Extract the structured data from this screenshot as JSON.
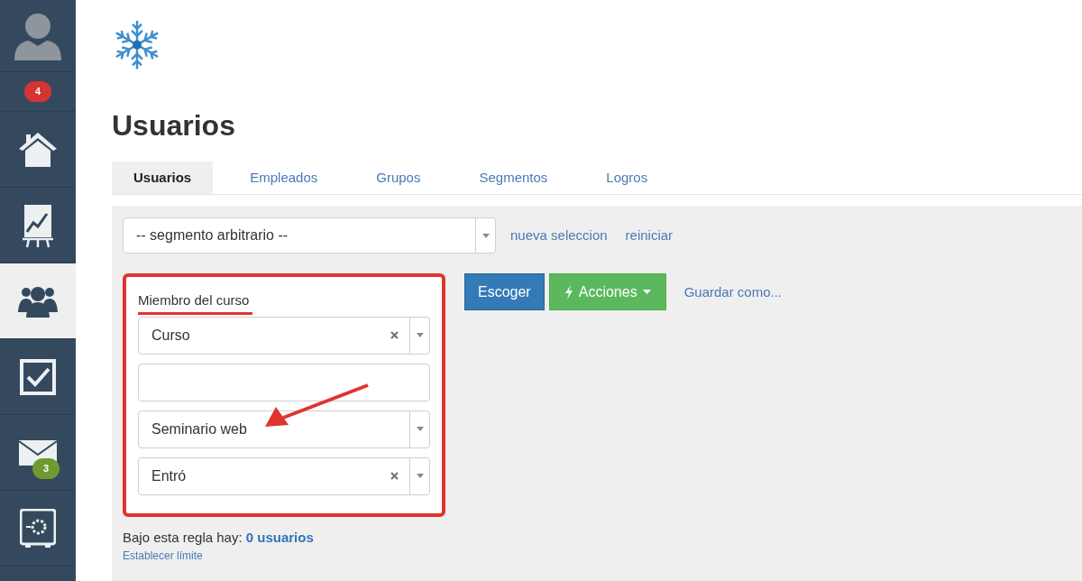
{
  "sidebar": {
    "badge": "4",
    "items": [
      {
        "selected": false
      },
      {
        "selected": false
      },
      {
        "selected": true
      },
      {
        "selected": false
      },
      {
        "selected": false,
        "badge": "3"
      },
      {
        "selected": false
      }
    ]
  },
  "title": "Usuarios",
  "tabs": [
    {
      "label": "Usuarios",
      "selected": true
    },
    {
      "label": "Empleados",
      "selected": false
    },
    {
      "label": "Grupos",
      "selected": false
    },
    {
      "label": "Segmentos",
      "selected": false
    },
    {
      "label": "Logros",
      "selected": false
    }
  ],
  "segment_select": {
    "value": "-- segmento arbitrario --"
  },
  "links": [
    "nueva seleccion",
    "reiniciar"
  ],
  "rule": {
    "title": "Miembro del curso",
    "fields": [
      {
        "kind": "select",
        "value": "Curso",
        "clearable": true
      },
      {
        "kind": "text"
      },
      {
        "kind": "select",
        "value": "Seminario web",
        "clearable": false
      },
      {
        "kind": "select",
        "value": "Entró",
        "clearable": true
      }
    ]
  },
  "buttons": [
    {
      "label": "Escoger",
      "kind": "primary"
    },
    {
      "label": "Acciones",
      "kind": "dropdown"
    }
  ],
  "save_link": "Guardar como...",
  "summary": {
    "text": "Bajo esta regla hay:",
    "count": "0 usuarios"
  },
  "limit_link": "Establecer límite"
}
